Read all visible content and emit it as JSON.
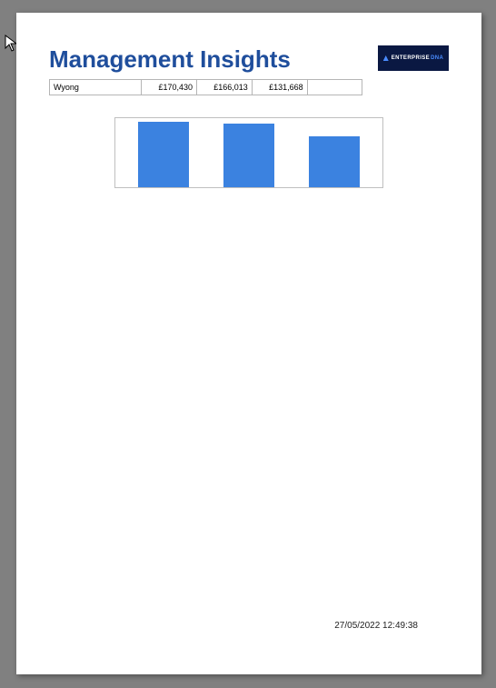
{
  "page_title": "Management Insights",
  "logo": {
    "label": "ENTERPRISE",
    "accent": "DNA"
  },
  "table": {
    "row_label": "Wyong",
    "cells": [
      "£170,430",
      "£166,013",
      "£131,668"
    ]
  },
  "footer_timestamp": "27/05/2022 12:49:38",
  "chart_data": {
    "type": "bar",
    "categories": [
      "",
      "",
      ""
    ],
    "values": [
      170430,
      166013,
      131668
    ],
    "title": "",
    "xlabel": "",
    "ylabel": "",
    "ylim": [
      0,
      180000
    ]
  }
}
